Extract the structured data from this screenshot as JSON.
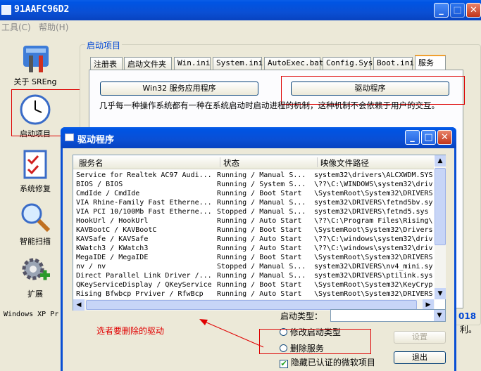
{
  "main_window": {
    "title": "91AAFC96D2"
  },
  "menu": {
    "items": [
      "工具(C)",
      "帮助(H)"
    ]
  },
  "sidebar": {
    "items": [
      {
        "label": "关于 SREng",
        "icon": "tools-icon"
      },
      {
        "label": "启动项目",
        "icon": "clock-icon"
      },
      {
        "label": "系统修复",
        "icon": "checklist-icon"
      },
      {
        "label": "智能扫描",
        "icon": "magnifier-icon"
      },
      {
        "label": "扩展",
        "icon": "gear-plus-icon"
      }
    ]
  },
  "group": {
    "title": "启动项目"
  },
  "tabs": [
    "注册表",
    "启动文件夹",
    "Win.ini",
    "System.ini",
    "AutoExec.bat",
    "Config.Sys",
    "Boot.ini",
    "服务"
  ],
  "service_buttons": {
    "win32": "Win32 服务应用程序",
    "driver": "驱动程序"
  },
  "description": "几乎每一种操作系统都有一种在系统启动时启动进程的机制，这种机制不会依赖于用户的交互。",
  "status_text": {
    "left": "Windows XP Pr",
    "right_year": "018",
    "right_suffix": "利。"
  },
  "dialog": {
    "title": "驱动程序",
    "columns": [
      "服务名",
      "状态",
      "映像文件路径"
    ],
    "rows": [
      [
        "Service for Realtek AC97 Audi...",
        "Running / Manual S...",
        "system32\\drivers\\ALCXWDM.SYS"
      ],
      [
        "BIOS / BIOS",
        "Running / System S...",
        "\\??\\C:\\WINDOWS\\system32\\driv"
      ],
      [
        "CmdIde / CmdIde",
        "Running / Boot Start",
        "\\SystemRoot\\System32\\DRIVERS"
      ],
      [
        "VIA Rhine-Family Fast Etherne...",
        "Running / Manual S...",
        "system32\\DRIVERS\\fetnd5bv.sy"
      ],
      [
        "VIA PCI 10/100Mb Fast Etherne...",
        "Stopped / Manual S...",
        "system32\\DRIVERS\\fetnd5.sys"
      ],
      [
        "HookUrl / HookUrl",
        "Running / Auto Start",
        "\\??\\C:\\Program Files\\Rising\\"
      ],
      [
        "KAVBootC / KAVBootC",
        "Running / Boot Start",
        "\\SystemRoot\\System32\\Drivers"
      ],
      [
        "KAVSafe / KAVSafe",
        "Running / Auto Start",
        "\\??\\C:\\windows\\system32\\driv"
      ],
      [
        "KWatch3 / KWatch3",
        "Running / Auto Start",
        "\\??\\C:\\windows\\system32\\driv"
      ],
      [
        "MegaIDE / MegaIDE",
        "Running / Boot Start",
        "\\SystemRoot\\System32\\DRIVERS"
      ],
      [
        "nv / nv",
        "Stopped / Manual S...",
        "system32\\DRIVERS\\nv4_mini.sy"
      ],
      [
        "Direct Parallel Link Driver /...",
        "Running / Manual S...",
        "system32\\DRIVERS\\ptilink.sys"
      ],
      [
        "QKeyServiceDisplay / QKeyService",
        "Running / Boot Start",
        "\\SystemRoot\\System32\\KeyCryp"
      ],
      [
        "Rising Bfwbcp Prviver / RfwBcp",
        "Running / Auto Start",
        "\\SystemRoot\\System32\\DRIVERS"
      ]
    ],
    "startup_type_label": "启动类型：",
    "radio_modify": "修改启动类型",
    "radio_delete": "删除服务",
    "checkbox_hide": "隐藏已认证的微软项目",
    "btn_set": "设置",
    "btn_exit": "退出",
    "annotation": "选者要删除的驱动"
  },
  "colors": {
    "annotation_red": "#e00000",
    "xp_blue": "#0054e3",
    "face": "#ece9d8"
  }
}
